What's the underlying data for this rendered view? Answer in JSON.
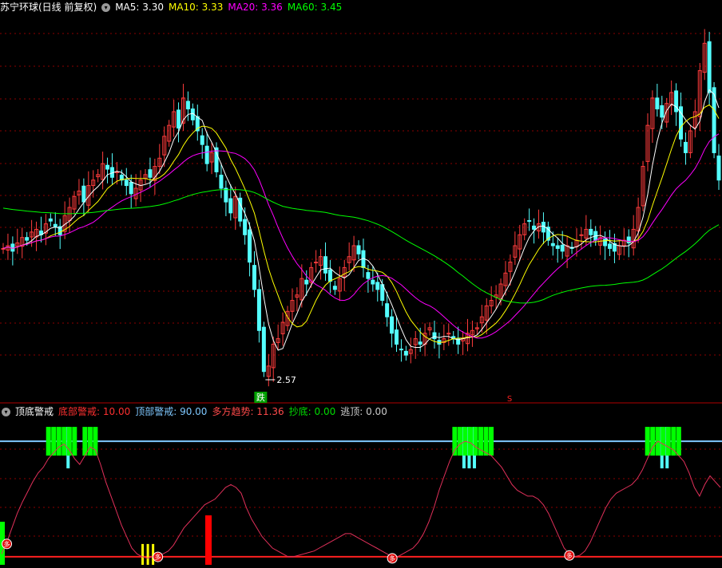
{
  "header": {
    "title": "苏宁环球(日线 前复权)",
    "ma": [
      {
        "label": "MA5: 3.30",
        "color": "#ffffff"
      },
      {
        "label": "MA10: 3.33",
        "color": "#ffff00"
      },
      {
        "label": "MA20: 3.36",
        "color": "#ff00ff"
      },
      {
        "label": "MA60: 3.45",
        "color": "#00ff00"
      }
    ]
  },
  "indicator_header": {
    "title": "顶底警戒",
    "items": [
      {
        "label": "底部警戒: 10.00",
        "color": "#ff3030"
      },
      {
        "label": "顶部警戒: 90.00",
        "color": "#7fc8ff"
      },
      {
        "label": "多方趋势: 11.36",
        "color": "#ff4a4a"
      },
      {
        "label": "抄底: 0.00",
        "color": "#00dd00"
      },
      {
        "label": "逃顶: 0.00",
        "color": "#cccccc"
      }
    ]
  },
  "annotations": {
    "low_price": "2.57",
    "down_marker": "跌",
    "sell_marker": "S",
    "buy_marker": "多"
  },
  "colors": {
    "up": "#ff3c3c",
    "down": "#54ffff",
    "ma5": "#ffffff",
    "ma10": "#ffff00",
    "ma20": "#ff00ff",
    "ma60": "#00ff00",
    "trend_line": "#e0305a",
    "top_line": "#7fc8ff",
    "bottom_line": "#ff2020",
    "grid": "#8b0000"
  },
  "chart_data": [
    {
      "type": "candlestick",
      "title": "苏宁环球(日线 前复权)",
      "ylim": [
        2.5,
        3.9
      ],
      "annotations": [
        {
          "text": "2.57",
          "value": 2.57
        }
      ],
      "series": [
        {
          "name": "MA5",
          "current": 3.3
        },
        {
          "name": "MA10",
          "current": 3.33
        },
        {
          "name": "MA20",
          "current": 3.36
        },
        {
          "name": "MA60",
          "current": 3.45
        }
      ],
      "close": [
        3.05,
        3.06,
        3.04,
        3.07,
        3.09,
        3.08,
        3.11,
        3.12,
        3.1,
        3.14,
        3.15,
        3.13,
        3.1,
        3.17,
        3.2,
        3.24,
        3.26,
        3.22,
        3.28,
        3.3,
        3.32,
        3.36,
        3.34,
        3.31,
        3.33,
        3.3,
        3.28,
        3.25,
        3.27,
        3.3,
        3.32,
        3.31,
        3.35,
        3.38,
        3.46,
        3.5,
        3.55,
        3.49,
        3.6,
        3.56,
        3.52,
        3.48,
        3.43,
        3.36,
        3.4,
        3.33,
        3.27,
        3.22,
        3.18,
        3.24,
        3.15,
        3.1,
        3.0,
        2.9,
        2.75,
        2.6,
        2.62,
        2.7,
        2.72,
        2.78,
        2.82,
        2.86,
        2.88,
        2.94,
        2.92,
        2.98,
        3.0,
        3.02,
        2.96,
        2.93,
        2.9,
        2.94,
        2.98,
        3.02,
        3.06,
        3.03,
        2.98,
        2.94,
        2.92,
        2.9,
        2.86,
        2.8,
        2.74,
        2.7,
        2.68,
        2.66,
        2.68,
        2.72,
        2.7,
        2.74,
        2.76,
        2.72,
        2.7,
        2.72,
        2.74,
        2.72,
        2.7,
        2.72,
        2.74,
        2.75,
        2.76,
        2.8,
        2.84,
        2.86,
        2.88,
        2.92,
        2.96,
        3.0,
        3.06,
        3.1,
        3.14,
        3.15,
        3.12,
        3.14,
        3.11,
        3.08,
        3.06,
        3.05,
        3.04,
        3.06,
        3.05,
        3.08,
        3.1,
        3.12,
        3.1,
        3.08,
        3.09,
        3.06,
        3.05,
        3.04,
        3.06,
        3.08,
        3.07,
        3.12,
        3.2,
        3.35,
        3.5,
        3.6,
        3.56,
        3.53,
        3.58,
        3.62,
        3.55,
        3.45,
        3.4,
        3.48,
        3.55,
        3.7,
        3.8,
        3.62,
        3.4,
        3.3
      ]
    },
    {
      "type": "line",
      "title": "顶底警戒",
      "ylim": [
        0,
        100
      ],
      "series": [
        {
          "name": "底部警戒",
          "current": 10.0
        },
        {
          "name": "顶部警戒",
          "current": 90.0
        },
        {
          "name": "多方趋势",
          "current": 11.36
        },
        {
          "name": "抄底",
          "current": 0.0
        },
        {
          "name": "逃顶",
          "current": 0.0
        }
      ],
      "trend": [
        12,
        20,
        30,
        40,
        48,
        55,
        62,
        68,
        72,
        78,
        82,
        86,
        88,
        84,
        78,
        74,
        80,
        86,
        84,
        74,
        62,
        52,
        42,
        32,
        24,
        16,
        12,
        10,
        9,
        10,
        11,
        12,
        14,
        18,
        24,
        30,
        34,
        38,
        42,
        46,
        48,
        50,
        54,
        58,
        60,
        58,
        54,
        44,
        36,
        30,
        24,
        20,
        16,
        14,
        12,
        10,
        10,
        11,
        12,
        13,
        14,
        16,
        18,
        20,
        22,
        24,
        26,
        26,
        24,
        22,
        20,
        18,
        16,
        14,
        12,
        10,
        10,
        12,
        14,
        16,
        20,
        26,
        34,
        44,
        56,
        66,
        76,
        84,
        88,
        90,
        89,
        86,
        84,
        82,
        80,
        76,
        72,
        66,
        60,
        56,
        54,
        52,
        52,
        50,
        46,
        40,
        32,
        24,
        16,
        12,
        10,
        11,
        14,
        20,
        28,
        36,
        44,
        50,
        54,
        56,
        58,
        60,
        64,
        70,
        78,
        86,
        90,
        88,
        86,
        84,
        80,
        76,
        68,
        58,
        52,
        60,
        66,
        62,
        58
      ]
    }
  ]
}
